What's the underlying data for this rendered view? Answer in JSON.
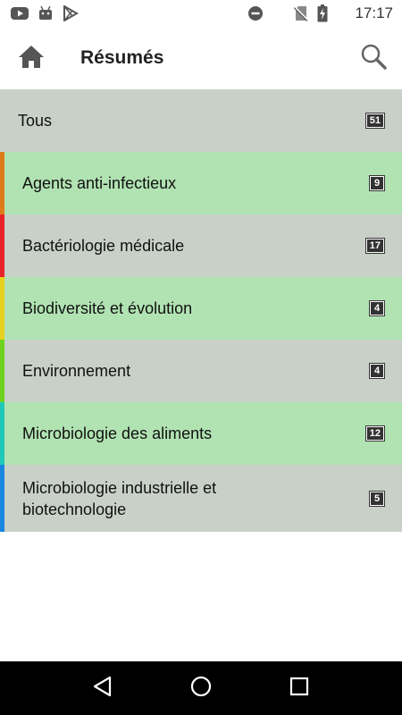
{
  "status_bar": {
    "time": "17:17",
    "left_icons": [
      "youtube-icon",
      "android-icon",
      "play-store-icon"
    ],
    "right_icons": [
      "do-not-disturb-icon",
      "no-sim-icon",
      "battery-charging-icon"
    ]
  },
  "app_bar": {
    "title": "Résumés",
    "home_icon": "home-icon",
    "search_icon": "search-icon"
  },
  "list": {
    "all": {
      "label": "Tous",
      "count": "51"
    },
    "categories": [
      {
        "label": "Agents anti-infectieux",
        "count": "9",
        "color": "#e07b1a",
        "bg": "#b1e3b2"
      },
      {
        "label": "Bactériologie médicale",
        "count": "17",
        "color": "#e8232a",
        "bg": "#c8d0c8"
      },
      {
        "label": "Biodiversité et évolution",
        "count": "4",
        "color": "#e8d21f",
        "bg": "#b1e3b2"
      },
      {
        "label": "Environnement",
        "count": "4",
        "color": "#6fd21c",
        "bg": "#c8d0c8"
      },
      {
        "label": "Microbiologie des aliments",
        "count": "12",
        "color": "#1fc8b8",
        "bg": "#b1e3b2"
      },
      {
        "label": "Microbiologie industrielle et biotechnologie",
        "count": "5",
        "color": "#1a86e0",
        "bg": "#c8d0c8"
      }
    ]
  },
  "nav_bar": {
    "icons": [
      "back-icon",
      "home-circle-icon",
      "recents-icon"
    ]
  }
}
